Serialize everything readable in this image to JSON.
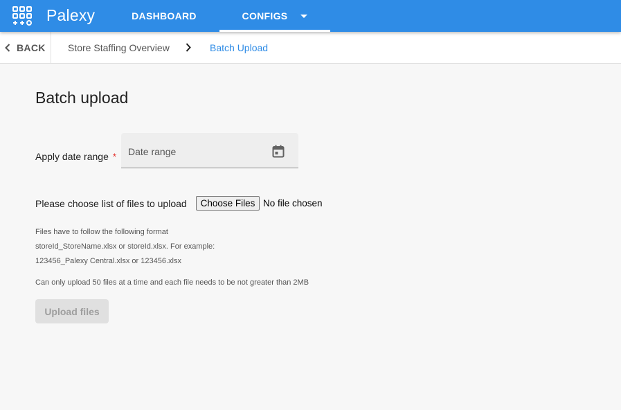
{
  "app": {
    "name": "Palexy",
    "icon": "apps-grid-icon",
    "brand_color": "#2f8ce6"
  },
  "nav": {
    "tabs": [
      {
        "label": "DASHBOARD",
        "active": false
      },
      {
        "label": "CONFIGS",
        "active": true,
        "has_dropdown": true
      }
    ]
  },
  "breadcrumb": {
    "back_label": "BACK",
    "items": [
      "Store Staffing Overview",
      "Batch Upload"
    ],
    "active_color": "#2f8ce6"
  },
  "page": {
    "title": "Batch upload"
  },
  "form": {
    "date_range": {
      "label": "Apply date range",
      "required_mark": "*",
      "placeholder": "Date range",
      "icon": "calendar-icon"
    },
    "files": {
      "label": "Please choose list of files to upload",
      "button_label": "Choose Files",
      "status": "No file chosen"
    },
    "help": [
      "Files have to follow the following format",
      "storeId_StoreName.xlsx or storeId.xlsx. For example:",
      "123456_Palexy Central.xlsx or 123456.xlsx",
      "Can only upload 50 files at a time and each file needs to be not greater than 2MB"
    ],
    "submit": {
      "label": "Upload files",
      "disabled": true
    }
  }
}
